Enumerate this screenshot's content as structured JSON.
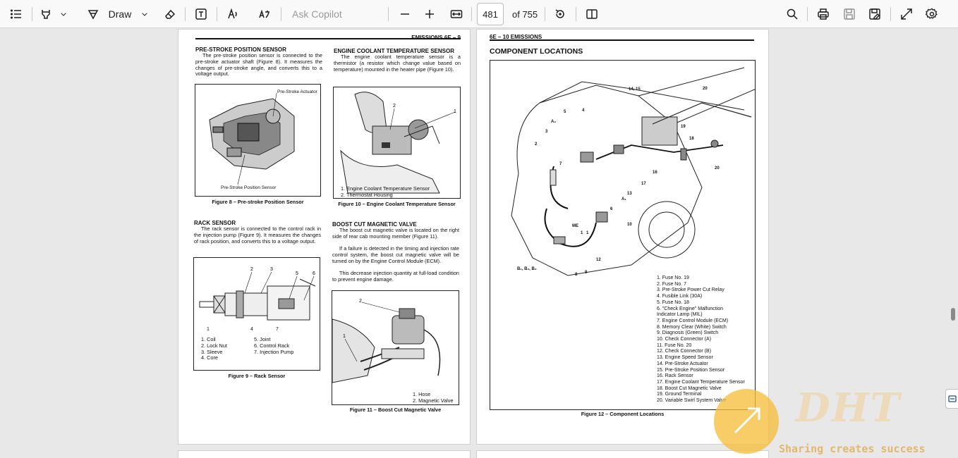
{
  "toolbar": {
    "draw_label": "Draw",
    "ask_copilot_placeholder": "Ask Copilot",
    "page_number": "481",
    "of_label": "of 755"
  },
  "page_left": {
    "header": "EMISSIONS  6E – 9",
    "sec1_title": "PRE-STROKE POSITION SENSOR",
    "sec1_body": "The pre-stroke position sensor is connected to the pre-stroke actuator shaft (Figure 8). It measures the changes of pre-stroke angle, and converts this to a voltage output.",
    "fig8_label_top": "Pre-Stroke Actuator",
    "fig8_label_bottom": "Pre-Stroke Position Sensor",
    "fig8_caption": "Figure 8 – Pre-stroke Position Sensor",
    "sec2_title": "ENGINE COOLANT TEMPERATURE SENSOR",
    "sec2_body": "The engine coolant temperature sensor is a thermistor (a resistor which change value based on temperature) mounted in the heater pipe (Figure 10).",
    "fig10_legend": [
      "1. Engine Coolant Temperature Sensor",
      "2. Thermostat Housing"
    ],
    "fig10_caption": "Figure 10 – Engine Coolant Temperature Sensor",
    "sec3_title": "RACK SENSOR",
    "sec3_body": "The rack sensor is connected to the control rack in the injection pump (Figure 9). It measures the changes of rack position, and converts this to a voltage output.",
    "fig9_legend_left": [
      "1. Coil",
      "2. Lock Nut",
      "3. Sleeve",
      "4. Core"
    ],
    "fig9_legend_right": [
      "5. Joint",
      "6. Control Rack",
      "7. Injection Pump"
    ],
    "fig9_caption": "Figure 9 – Rack Sensor",
    "sec4_title": "BOOST CUT MAGNETIC VALVE",
    "sec4_body1": "The boost cut magnetic valve is located on the right side of rear cab mounting member (Figure 11).",
    "sec4_body2": "If a failure is detected in the timing and injection rate control system, the boost cut magnetic valve will be turned on by the Engine Control Module (ECM).",
    "sec4_body3": "This decrease injection quantity at full-load condition to prevent engine damage.",
    "fig11_legend": [
      "1. Hose",
      "2. Magnetic Valve"
    ],
    "fig11_caption": "Figure 11 – Boost Cut Magnetic Valve"
  },
  "page_right": {
    "header": "6E – 10  EMISSIONS",
    "title": "COMPONENT LOCATIONS",
    "legend": [
      "1.  Fuse No. 19",
      "2.  Fuse No. 7",
      "3.  Pre-Stroke Power Cut Relay",
      "4.  Fusible Link (30A)",
      "5.  Fuse No. 18",
      "6.  \"Check Engine\" Malfunction",
      "     Indicator Lamp (MIL)",
      "7.  Engine Control Module (ECM)",
      "8.  Memory Clear (White) Switch",
      "9.  Diagnosis (Green) Switch",
      "10. Check Connector (A)",
      "11. Fuse No. 20",
      "12. Check Connector (B)",
      "13. Engine Speed Sensor",
      "14. Pre-Stroke Actuator",
      "15. Pre-Stroke Position Sensor",
      "16. Rack Sensor",
      "17. Engine Coolant Temperature Sensor",
      "18. Boost Cut Magnetic Valve",
      "19. Ground Terminal",
      "20. Variable Swirl System Valve"
    ],
    "caption": "Figure 12 – Component Locations"
  },
  "watermark": {
    "brand": "DHT",
    "slogan": "Sharing creates success"
  },
  "icons": [
    "contents-icon",
    "highlight-icon",
    "draw-icon",
    "eraser-icon",
    "text-box-icon",
    "read-aloud-icon",
    "translate-icon",
    "zoom-out-icon",
    "zoom-in-icon",
    "fit-width-icon",
    "rotate-icon",
    "page-view-icon",
    "search-icon",
    "print-icon",
    "save-icon",
    "save-as-icon",
    "fullscreen-icon",
    "settings-icon"
  ]
}
